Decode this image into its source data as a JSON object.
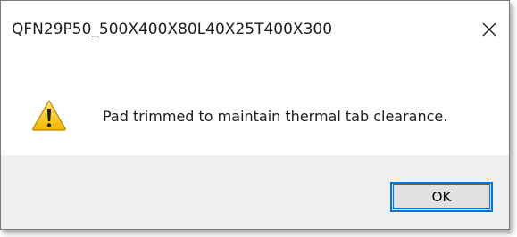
{
  "window": {
    "title": "QFN29P50_500X400X80L40X25T400X300",
    "close_icon": "close-icon"
  },
  "content": {
    "icon": "warning-icon",
    "message": "Pad trimmed to maintain thermal tab clearance."
  },
  "footer": {
    "ok_label": "OK"
  },
  "colors": {
    "accent": "#0078d7",
    "footer_bg": "#f0f0f0",
    "warning_yellow": "#f4c51b"
  }
}
